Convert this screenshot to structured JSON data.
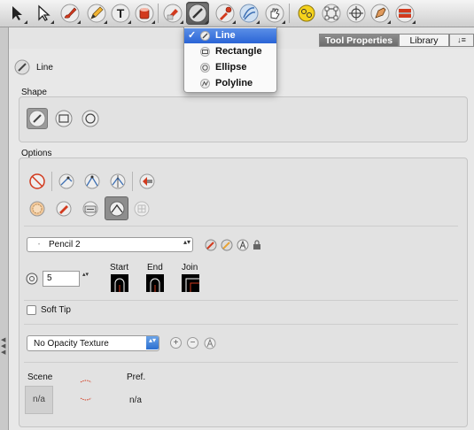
{
  "toolbar": {
    "tools": [
      {
        "name": "select-tool-icon"
      },
      {
        "name": "contour-editor-icon"
      },
      {
        "name": "brush-tool-icon"
      },
      {
        "name": "pencil-tool-icon"
      },
      {
        "name": "text-tool-icon"
      },
      {
        "name": "paint-bucket-icon"
      },
      {
        "name": "shape-tool-icon",
        "active": true
      },
      {
        "name": "eyedropper-icon"
      },
      {
        "name": "stroke-tool-icon"
      },
      {
        "name": "hand-tool-icon"
      },
      {
        "name": "drawing-pivot-icon"
      },
      {
        "name": "transform-tool-icon"
      },
      {
        "name": "cutter-tool-icon"
      },
      {
        "name": "pen-tool-icon"
      },
      {
        "name": "camera-tool-icon"
      }
    ],
    "text_tool_glyph": "T"
  },
  "panel": {
    "tabs": {
      "tool_properties": "Tool Properties",
      "library": "Library"
    },
    "tab_controls": "↓≡"
  },
  "dropdown": {
    "items": [
      {
        "label": "Line",
        "checked": true,
        "check_glyph": "✓"
      },
      {
        "label": "Rectangle"
      },
      {
        "label": "Ellipse"
      },
      {
        "label": "Polyline"
      }
    ]
  },
  "tool": {
    "name": "Line"
  },
  "shape": {
    "label": "Shape"
  },
  "options": {
    "label": "Options"
  },
  "pencil": {
    "selected": "Pencil 2",
    "arrows": "▴▾"
  },
  "size": {
    "value": "5",
    "arrows": "▴▾"
  },
  "caps": {
    "start": "Start",
    "end": "End",
    "join": "Join"
  },
  "soft_tip": {
    "label": "Soft Tip",
    "checked": false
  },
  "opacity_texture": {
    "selected": "No Opacity Texture",
    "arrows": "▴▾",
    "add": "+",
    "remove": "−"
  },
  "scene": {
    "label": "Scene",
    "value": "n/a"
  },
  "pref": {
    "label": "Pref.",
    "value": "n/a"
  },
  "colors": {
    "accent": "#2a64d6",
    "brush_red": "#d23a1e"
  }
}
